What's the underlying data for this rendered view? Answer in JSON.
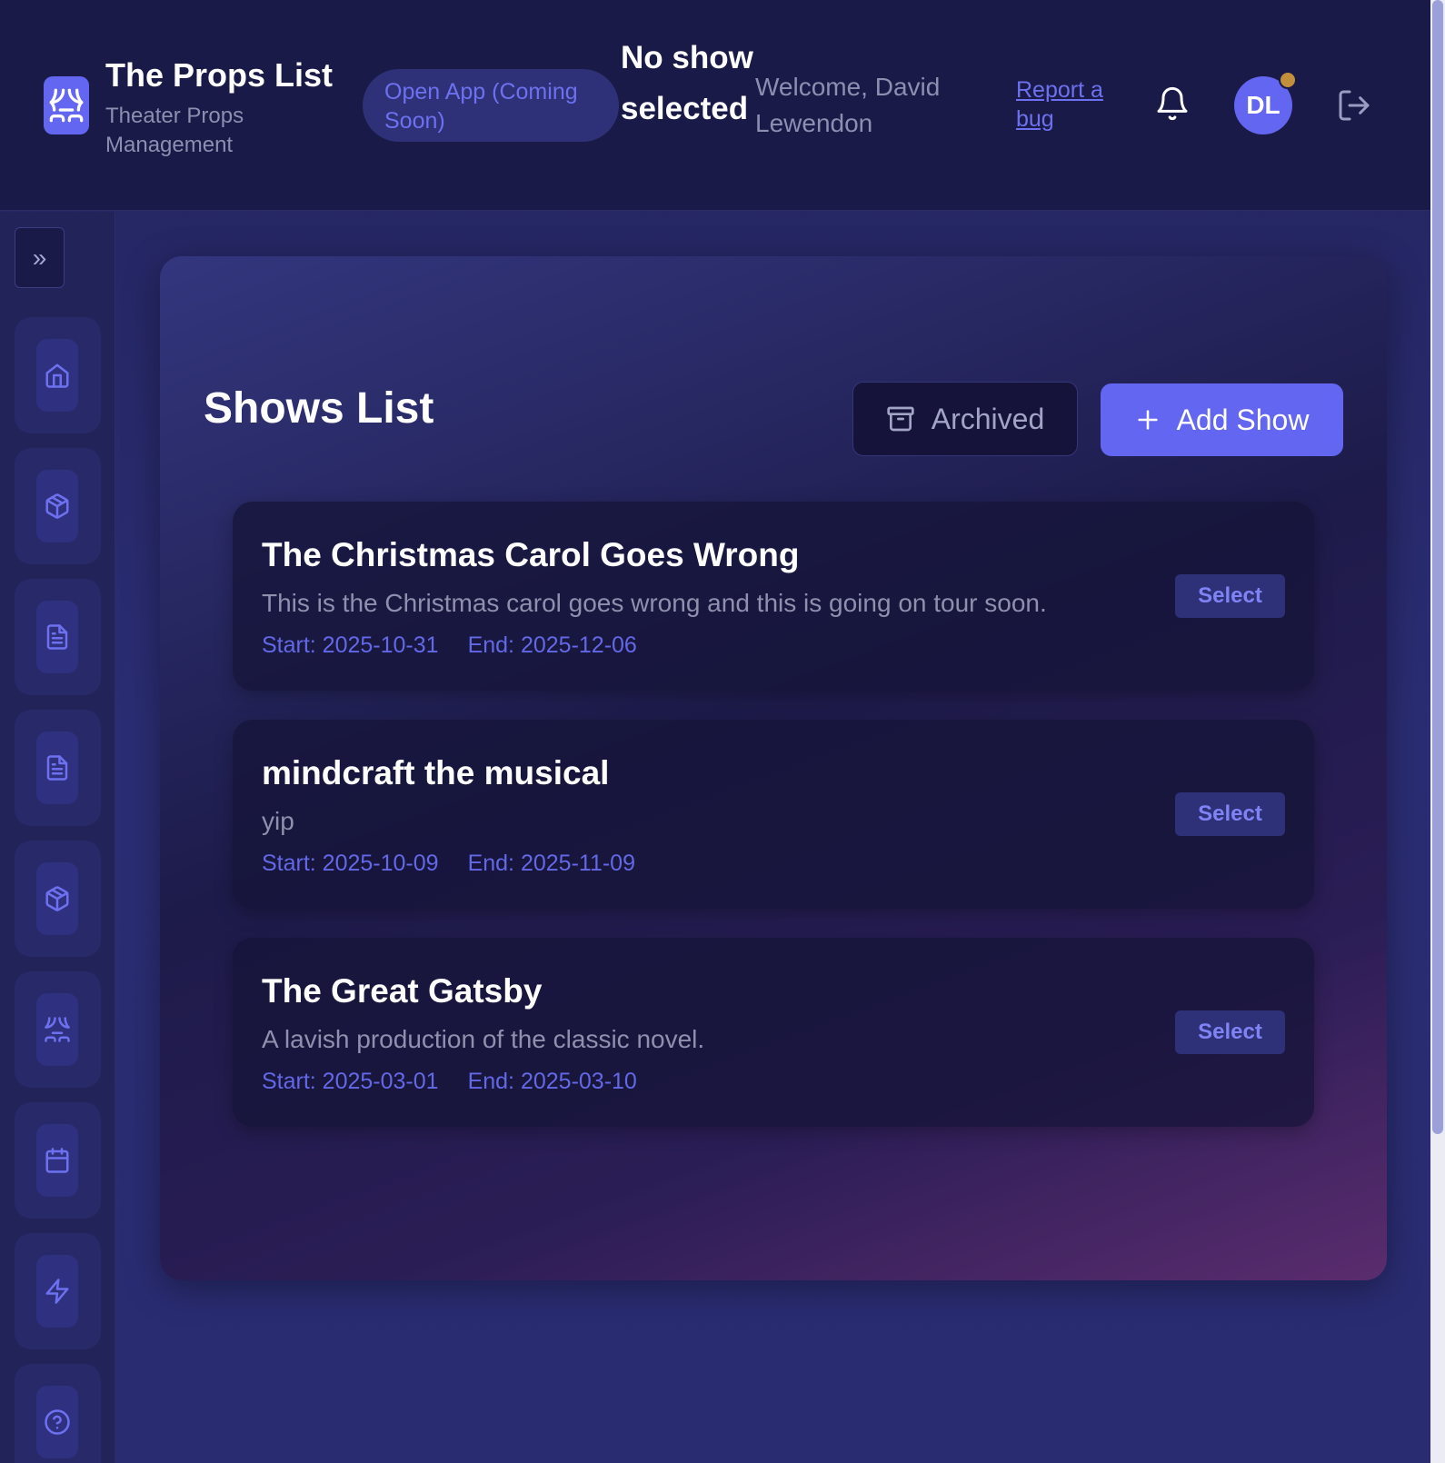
{
  "header": {
    "brand_title": "The Props List",
    "brand_subtitle": "Theater Props Management",
    "open_app_label": "Open App (Coming Soon)",
    "no_show_label": "No show selected",
    "welcome_text": "Welcome, David Lewendon",
    "report_bug_label": "Report a bug",
    "avatar_initials": "DL",
    "icons": [
      "theater-masks-icon",
      "bell-icon",
      "logout-icon"
    ]
  },
  "sidebar": {
    "expand_icon": "chevrons-right-icon",
    "items": [
      {
        "icon": "home-icon"
      },
      {
        "icon": "box-icon"
      },
      {
        "icon": "document-icon"
      },
      {
        "icon": "document-icon"
      },
      {
        "icon": "box-icon"
      },
      {
        "icon": "theater-masks-icon"
      },
      {
        "icon": "calendar-icon"
      },
      {
        "icon": "lightning-icon"
      },
      {
        "icon": "help-circle-icon"
      }
    ]
  },
  "main": {
    "title": "Shows List",
    "archived_label": "Archived",
    "add_show_label": "Add Show",
    "shows": [
      {
        "title": "The Christmas Carol Goes Wrong",
        "description": "This is the Christmas carol goes wrong and this is going on tour soon.",
        "start": "Start: 2025-10-31",
        "end": "End: 2025-12-06",
        "select_label": "Select"
      },
      {
        "title": "mindcraft the musical",
        "description": "yip",
        "start": "Start: 2025-10-09",
        "end": "End: 2025-11-09",
        "select_label": "Select"
      },
      {
        "title": "The Great Gatsby",
        "description": "A lavish production of the classic novel.",
        "start": "Start: 2025-03-01",
        "end": "End: 2025-03-10",
        "select_label": "Select"
      }
    ]
  },
  "colors": {
    "accent": "#6366f1",
    "header_bg": "#1a1a48",
    "notification_dot": "#c28f3a"
  }
}
